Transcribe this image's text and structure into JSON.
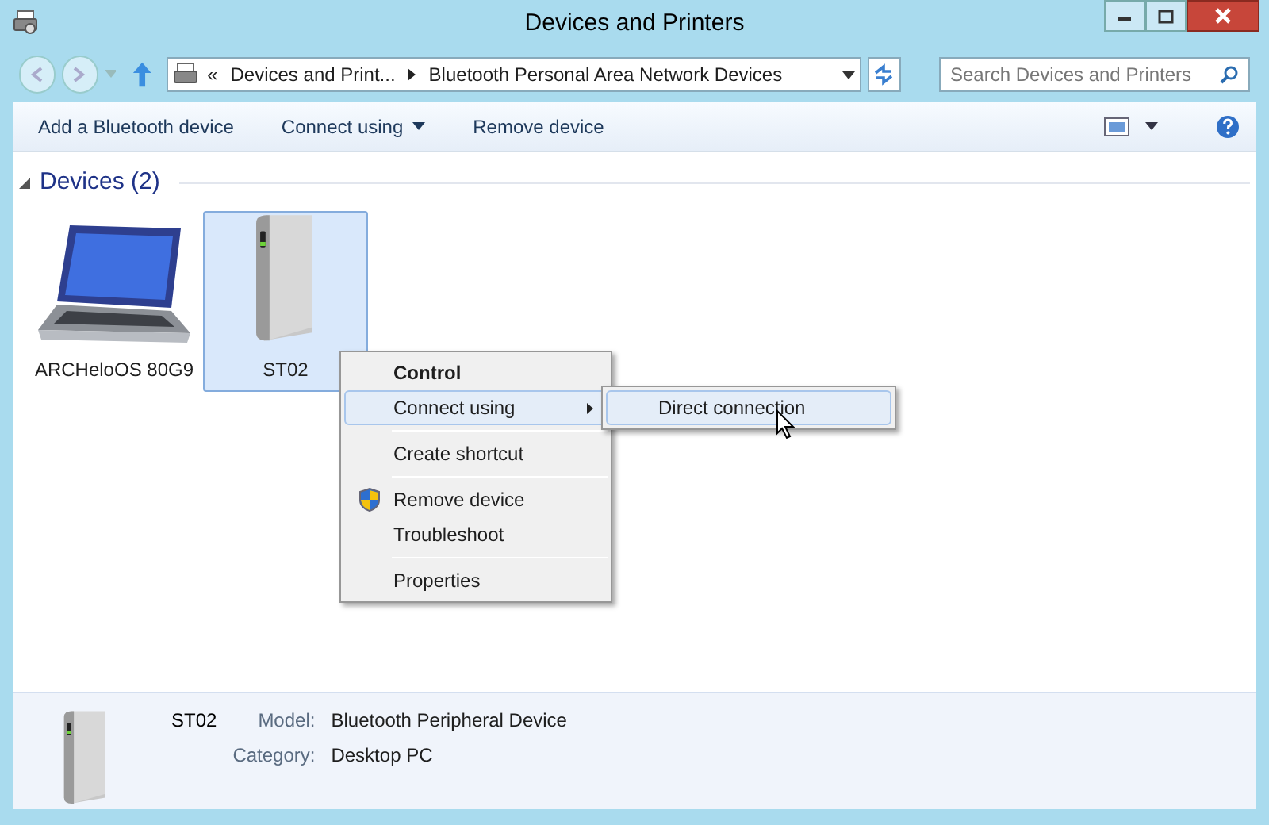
{
  "window": {
    "title": "Devices and Printers"
  },
  "address_bar": {
    "overflow": "«",
    "crumbs": [
      "Devices and Print...",
      "Bluetooth Personal Area Network Devices"
    ]
  },
  "search": {
    "placeholder": "Search Devices and Printers"
  },
  "toolbar": [
    {
      "label": "Add a Bluetooth device",
      "dropdown": false
    },
    {
      "label": "Connect using",
      "dropdown": true
    },
    {
      "label": "Remove device",
      "dropdown": false
    }
  ],
  "group": {
    "title": "Devices (2)",
    "expanded": true
  },
  "devices": [
    {
      "name": "ARCHeloOS 80G9",
      "kind": "laptop",
      "selected": false
    },
    {
      "name": "ST02",
      "kind": "drive",
      "selected": true
    }
  ],
  "context_menu": [
    {
      "kind": "item",
      "label": "Control",
      "default": true,
      "submenu": false,
      "shield": false,
      "selected": false
    },
    {
      "kind": "item",
      "label": "Connect using",
      "default": false,
      "submenu": true,
      "shield": false,
      "selected": true
    },
    {
      "kind": "separator"
    },
    {
      "kind": "item",
      "label": "Create shortcut",
      "default": false,
      "submenu": false,
      "shield": false,
      "selected": false
    },
    {
      "kind": "separator"
    },
    {
      "kind": "item",
      "label": "Remove device",
      "default": false,
      "submenu": false,
      "shield": true,
      "selected": false
    },
    {
      "kind": "item",
      "label": "Troubleshoot",
      "default": false,
      "submenu": false,
      "shield": false,
      "selected": false
    },
    {
      "kind": "separator"
    },
    {
      "kind": "item",
      "label": "Properties",
      "default": false,
      "submenu": false,
      "shield": false,
      "selected": false
    }
  ],
  "submenu": [
    {
      "label": "Direct connection",
      "selected": true
    }
  ],
  "details": {
    "name": "ST02",
    "kind": "drive",
    "fields": [
      {
        "label": "Model:",
        "value": "Bluetooth Peripheral Device"
      },
      {
        "label": "Category:",
        "value": "Desktop PC"
      }
    ]
  }
}
